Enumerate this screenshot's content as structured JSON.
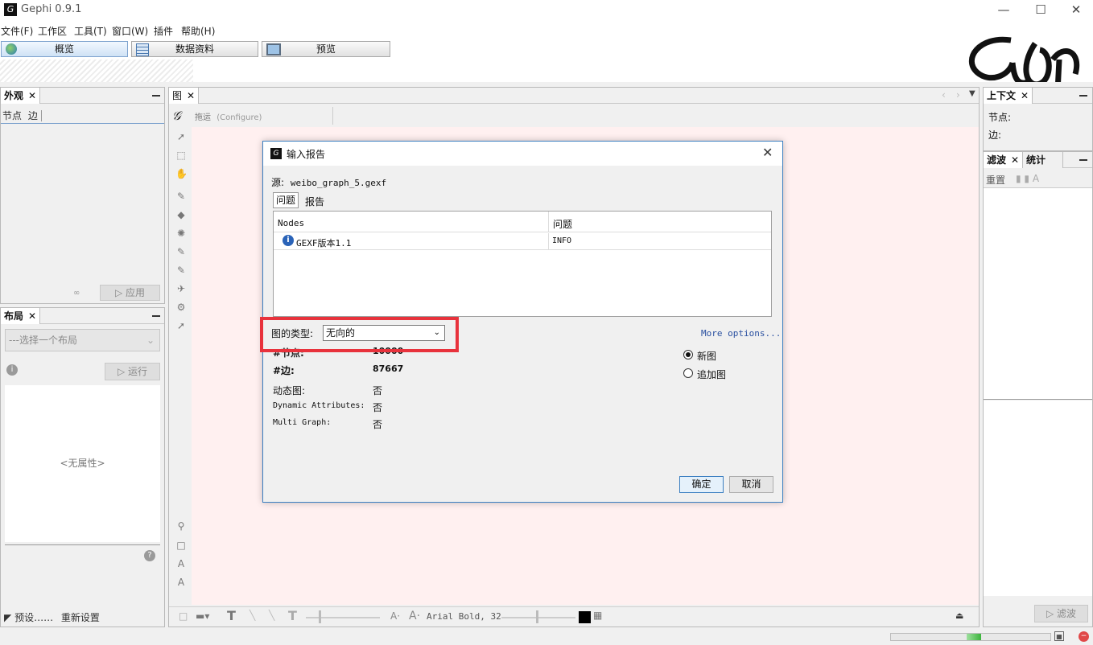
{
  "window": {
    "title": "Gephi 0.9.1",
    "logo_text": "G"
  },
  "menu": [
    "文件(F)",
    "工作区",
    "工具(T)",
    "窗口(W)",
    "插件",
    "帮助(H)"
  ],
  "workspace_tabs": [
    {
      "label": "概览",
      "active": true
    },
    {
      "label": "数据资料",
      "active": false
    },
    {
      "label": "预览",
      "active": false
    }
  ],
  "appearance_panel": {
    "tab": "外观",
    "subtabs": [
      "节点",
      "边"
    ],
    "apply_label": "应用"
  },
  "layout_panel": {
    "tab": "布局",
    "select_placeholder": "---选择一个布局",
    "run_label": "运行",
    "no_properties": "<无属性>",
    "preset_label": "预设……",
    "reset_label": "重新设置"
  },
  "graph_panel": {
    "tab": "图",
    "drag_label": "拖运",
    "configure_label": "(Configure)",
    "font_label": "Arial Bold, 32"
  },
  "context_panel": {
    "tab": "上下文",
    "nodes_label": "节点:",
    "edges_label": "边:"
  },
  "filter_panel": {
    "tabs": [
      "滤波",
      "统计"
    ],
    "reset_label": "重置",
    "filter_button": "滤波"
  },
  "import_dialog": {
    "title": "输入报告",
    "source_label": "源:",
    "source_file": "weibo_graph_5.gexf",
    "tabs": [
      "问题",
      "报告"
    ],
    "columns": [
      "Nodes",
      "问题"
    ],
    "rows": [
      {
        "node": "GEXF版本1.1",
        "issue": "INFO"
      }
    ],
    "graph_type_label": "图的类型:",
    "graph_type_value": "无向的",
    "more_options": "More options...",
    "stats": [
      {
        "label": "#节点:",
        "value": "10000",
        "bold": true
      },
      {
        "label": "#边:",
        "value": "87667",
        "bold": true
      },
      {
        "label": "动态图:",
        "value": "否",
        "bold": false
      },
      {
        "label": "Dynamic Attributes:",
        "value": "否",
        "bold": false
      },
      {
        "label": "Multi Graph:",
        "value": "否",
        "bold": false
      }
    ],
    "radio_new": "新图",
    "radio_append": "追加图",
    "ok_label": "确定",
    "cancel_label": "取消"
  },
  "colors": {
    "accent_highlight": "#e8323c",
    "canvas_bg": "#fff0f0",
    "dialog_border": "#3c7fc1"
  },
  "icons": [
    "gephi-logo-icon",
    "globe-icon",
    "table-icon",
    "monitor-icon",
    "info-icon",
    "help-icon",
    "close-icon"
  ]
}
